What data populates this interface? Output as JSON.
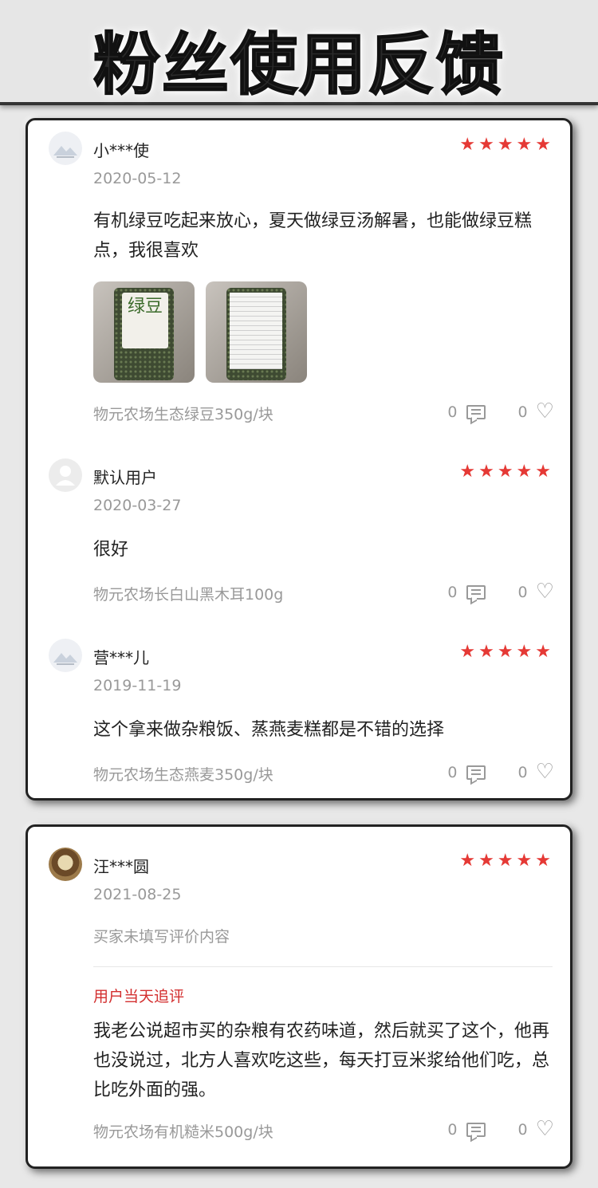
{
  "header": {
    "title": "粉丝使用反馈"
  },
  "cards": [
    {
      "reviews": [
        {
          "username": "小***使",
          "stars": "★★★★★",
          "date": "2020-05-12",
          "content": "有机绿豆吃起来放心，夏天做绿豆汤解暑，也能做绿豆糕点，我很喜欢",
          "photo1_label": "绿豆",
          "product": "物元农场生态绿豆350g/块",
          "comments": "0",
          "likes": "0"
        },
        {
          "username": "默认用户",
          "stars": "★★★★★",
          "date": "2020-03-27",
          "content": "很好",
          "product": "物元农场长白山黑木耳100g",
          "comments": "0",
          "likes": "0"
        },
        {
          "username": "营***儿",
          "stars": "★★★★★",
          "date": "2019-11-19",
          "content": "这个拿来做杂粮饭、蒸燕麦糕都是不错的选择",
          "product": "物元农场生态燕麦350g/块",
          "comments": "0",
          "likes": "0"
        }
      ]
    },
    {
      "reviews": [
        {
          "username": "汪***圆",
          "stars": "★★★★★",
          "date": "2021-08-25",
          "content": "买家未填写评价内容",
          "followup_label": "用户当天追评",
          "followup_content": "我老公说超市买的杂粮有农药味道，然后就买了这个，他再也没说过，北方人喜欢吃这些，每天打豆米浆给他们吃，总比吃外面的强。",
          "product": "物元农场有机糙米500g/块",
          "comments": "0",
          "likes": "0"
        }
      ]
    }
  ],
  "colors": {
    "star": "#e53935",
    "followup": "#d32f2f",
    "muted": "#999999"
  },
  "icons": {
    "comment": "comment-icon",
    "like": "heart-icon"
  }
}
